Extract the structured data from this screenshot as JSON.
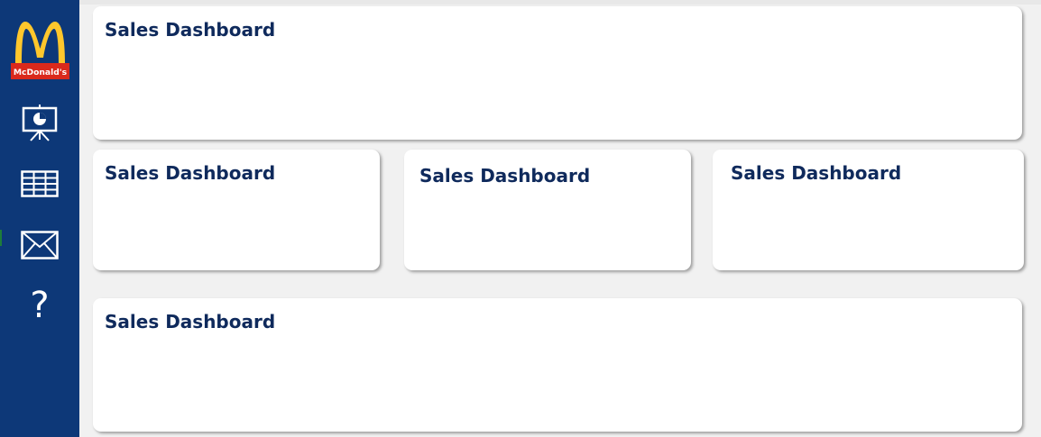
{
  "brand": {
    "logo_text": "McDonald's",
    "logo_colors": {
      "arches": "#ffc72c",
      "banner": "#da291c"
    }
  },
  "sidebar": {
    "background": "#0d3878",
    "items": [
      {
        "icon": "presentation-icon"
      },
      {
        "icon": "table-icon"
      },
      {
        "icon": "mail-icon"
      },
      {
        "icon": "help-icon",
        "glyph": "?"
      }
    ]
  },
  "cards": {
    "top": {
      "title": "Sales Dashboard"
    },
    "middle_left": {
      "title": "Sales Dashboard"
    },
    "middle_center": {
      "title": "Sales Dashboard"
    },
    "middle_right": {
      "title": "Sales Dashboard"
    },
    "bottom": {
      "title": "Sales Dashboard"
    }
  },
  "colors": {
    "title": "#0f2a5c",
    "canvas": "#f1f1f1",
    "card": "#ffffff"
  }
}
